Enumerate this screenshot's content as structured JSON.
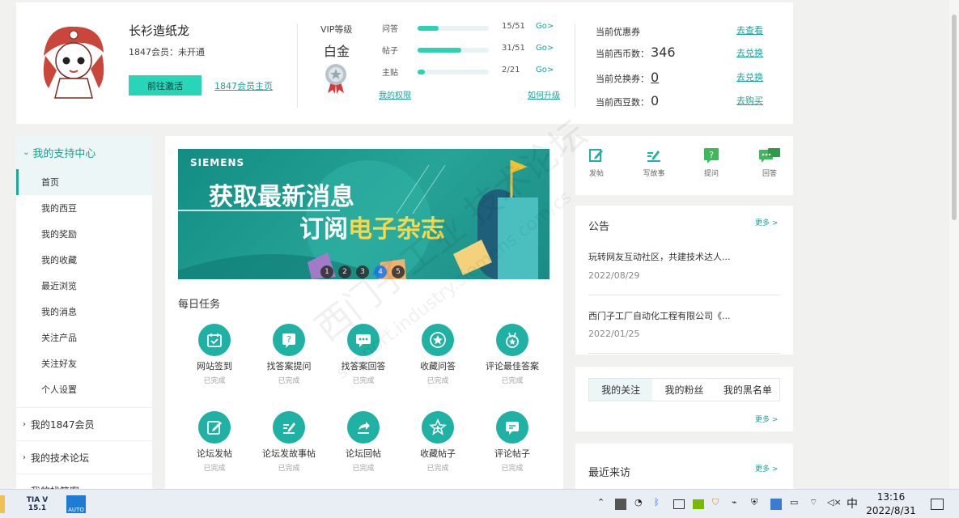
{
  "profile": {
    "username": "长衫造纸龙",
    "membership": "1847会员：未开通",
    "activate_label": "前往激活",
    "homepage_link": "1847会员主页"
  },
  "vip": {
    "title": "VIP等级",
    "level": "白金"
  },
  "stats": [
    {
      "label": "问答",
      "count": "15/51",
      "go": "Go>",
      "progress": 0.29
    },
    {
      "label": "帖子",
      "count": "31/51",
      "go": "Go>",
      "progress": 0.61
    },
    {
      "label": "主贴",
      "count": "2/21",
      "go": "Go>",
      "progress": 0.1
    }
  ],
  "links": {
    "my_privileges": "我的权限",
    "how_upgrade": "如何升级"
  },
  "assets": [
    {
      "label": "当前优惠券",
      "value": "",
      "link": "去查看"
    },
    {
      "label": "当前西币数：",
      "value": "346",
      "link": "去兑换"
    },
    {
      "label": "当前兑换券：",
      "value": "0",
      "link": "去兑换"
    },
    {
      "label": "当前西豆数：",
      "value": "0",
      "link": "去购买"
    }
  ],
  "sidebar": {
    "header": "我的支持中心",
    "items": [
      "首页",
      "我的西豆",
      "我的奖励",
      "我的收藏",
      "最近浏览",
      "我的消息",
      "关注产品",
      "关注好友",
      "个人设置"
    ],
    "groups": [
      "我的1847会员",
      "我的技术论坛",
      "我的找答案"
    ]
  },
  "banner": {
    "brand": "SIEMENS",
    "line1": "获取最新消息",
    "line2a": "订阅",
    "line2b": "电子杂志",
    "dots": [
      "1",
      "2",
      "3",
      "4",
      "5"
    ],
    "active_dot": 4
  },
  "daily": {
    "title": "每日任务",
    "tasks": [
      {
        "label": "网站签到",
        "status": "已完成",
        "icon": "calendar-check-icon"
      },
      {
        "label": "找答案提问",
        "status": "已完成",
        "icon": "question-icon"
      },
      {
        "label": "找答案回答",
        "status": "已完成",
        "icon": "chat-dots-icon"
      },
      {
        "label": "收藏问答",
        "status": "已完成",
        "icon": "star-icon"
      },
      {
        "label": "评论最佳答案",
        "status": "已完成",
        "icon": "medal-icon"
      },
      {
        "label": "论坛发帖",
        "status": "已完成",
        "icon": "edit-icon"
      },
      {
        "label": "论坛发故事帖",
        "status": "已完成",
        "icon": "write-icon"
      },
      {
        "label": "论坛回帖",
        "status": "已完成",
        "icon": "reply-icon"
      },
      {
        "label": "收藏帖子",
        "status": "已完成",
        "icon": "star-plus-icon"
      },
      {
        "label": "评论帖子",
        "status": "已完成",
        "icon": "comment-icon"
      }
    ]
  },
  "quick_actions": [
    {
      "label": "发帖"
    },
    {
      "label": "写故事"
    },
    {
      "label": "提问"
    },
    {
      "label": "回答"
    }
  ],
  "notice": {
    "title": "公告",
    "more": "更多 >",
    "items": [
      {
        "text": "玩转网友互动社区，共建技术达人...",
        "date": "2022/08/29"
      },
      {
        "text": "西门子工厂自动化工程有限公司《...",
        "date": "2022/01/25"
      }
    ]
  },
  "follow": {
    "tabs": [
      "我的关注",
      "我的粉丝",
      "我的黑名单"
    ],
    "more": "更多 >"
  },
  "recent": {
    "title": "最近来访",
    "more": "更多 >"
  },
  "watermark": {
    "cn": "西门子工业 技术论坛",
    "url": "support.industry.siemens.com/cs"
  },
  "taskbar": {
    "apps": [
      "TIA V15.1",
      "AUTO"
    ],
    "ime": "中",
    "time": "13:16",
    "date": "2022/8/31"
  },
  "colors": {
    "accent": "#1eb1a4",
    "button": "#28d5b9",
    "background": "#f1f1ef"
  }
}
